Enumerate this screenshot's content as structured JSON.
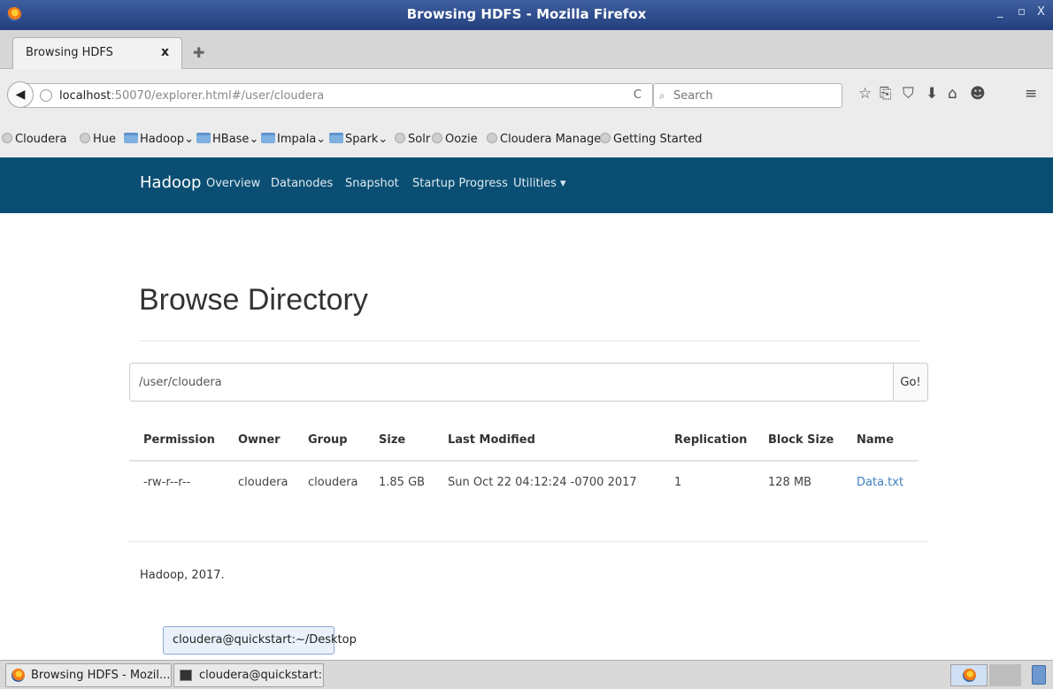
{
  "window": {
    "title": "Browsing HDFS - Mozilla Firefox",
    "controls": [
      "_",
      "▫",
      "X"
    ]
  },
  "tabs": [
    {
      "label": "Browsing HDFS",
      "close": "x"
    }
  ],
  "newtab_icon": "✚",
  "nav": {
    "url_host": "localhost",
    "url_rest": ":50070/explorer.html#/user/cloudera",
    "reload_icon": "C",
    "search_icon": "⌕",
    "search_placeholder": "Search",
    "toolbar_icons": [
      "☆",
      "⎘",
      "⛉",
      "⬇",
      "⌂",
      "☻",
      "≡"
    ]
  },
  "bookmarks": [
    {
      "label": "Cloudera",
      "kind": "globe"
    },
    {
      "label": "Hue",
      "kind": "globe"
    },
    {
      "label": "Hadoop",
      "kind": "folder"
    },
    {
      "label": "HBase",
      "kind": "folder"
    },
    {
      "label": "Impala",
      "kind": "folder"
    },
    {
      "label": "Spark",
      "kind": "folder"
    },
    {
      "label": "Solr",
      "kind": "globe"
    },
    {
      "label": "Oozie",
      "kind": "globe"
    },
    {
      "label": "Cloudera Manager",
      "kind": "globe"
    },
    {
      "label": "Getting Started",
      "kind": "globe"
    }
  ],
  "bookmark_chevron": "⌄",
  "hadoop_nav": {
    "brand": "Hadoop",
    "links": [
      "Overview",
      "Datanodes",
      "Snapshot",
      "Startup Progress",
      "Utilities ▾"
    ]
  },
  "page": {
    "title": "Browse Directory",
    "path_value": "/user/cloudera",
    "go_label": "Go!",
    "footer": "Hadoop, 2017."
  },
  "table": {
    "headers": [
      "Permission",
      "Owner",
      "Group",
      "Size",
      "Last Modified",
      "Replication",
      "Block Size",
      "Name"
    ],
    "rows": [
      [
        "-rw-r--r--",
        "cloudera",
        "cloudera",
        "1.85 GB",
        "Sun Oct 22 04:12:24 -0700 2017",
        "1",
        "128 MB",
        "Data.txt"
      ]
    ]
  },
  "tooltip": "cloudera@quickstart:~/Desktop",
  "taskbar": {
    "tasks": [
      "Browsing HDFS - Mozil...",
      "cloudera@quickstart:~..."
    ]
  },
  "colors": {
    "hadoop_nav_bg": "#0a4f73",
    "link": "#3a7fc0",
    "titlebar": "#2f4e8f"
  }
}
